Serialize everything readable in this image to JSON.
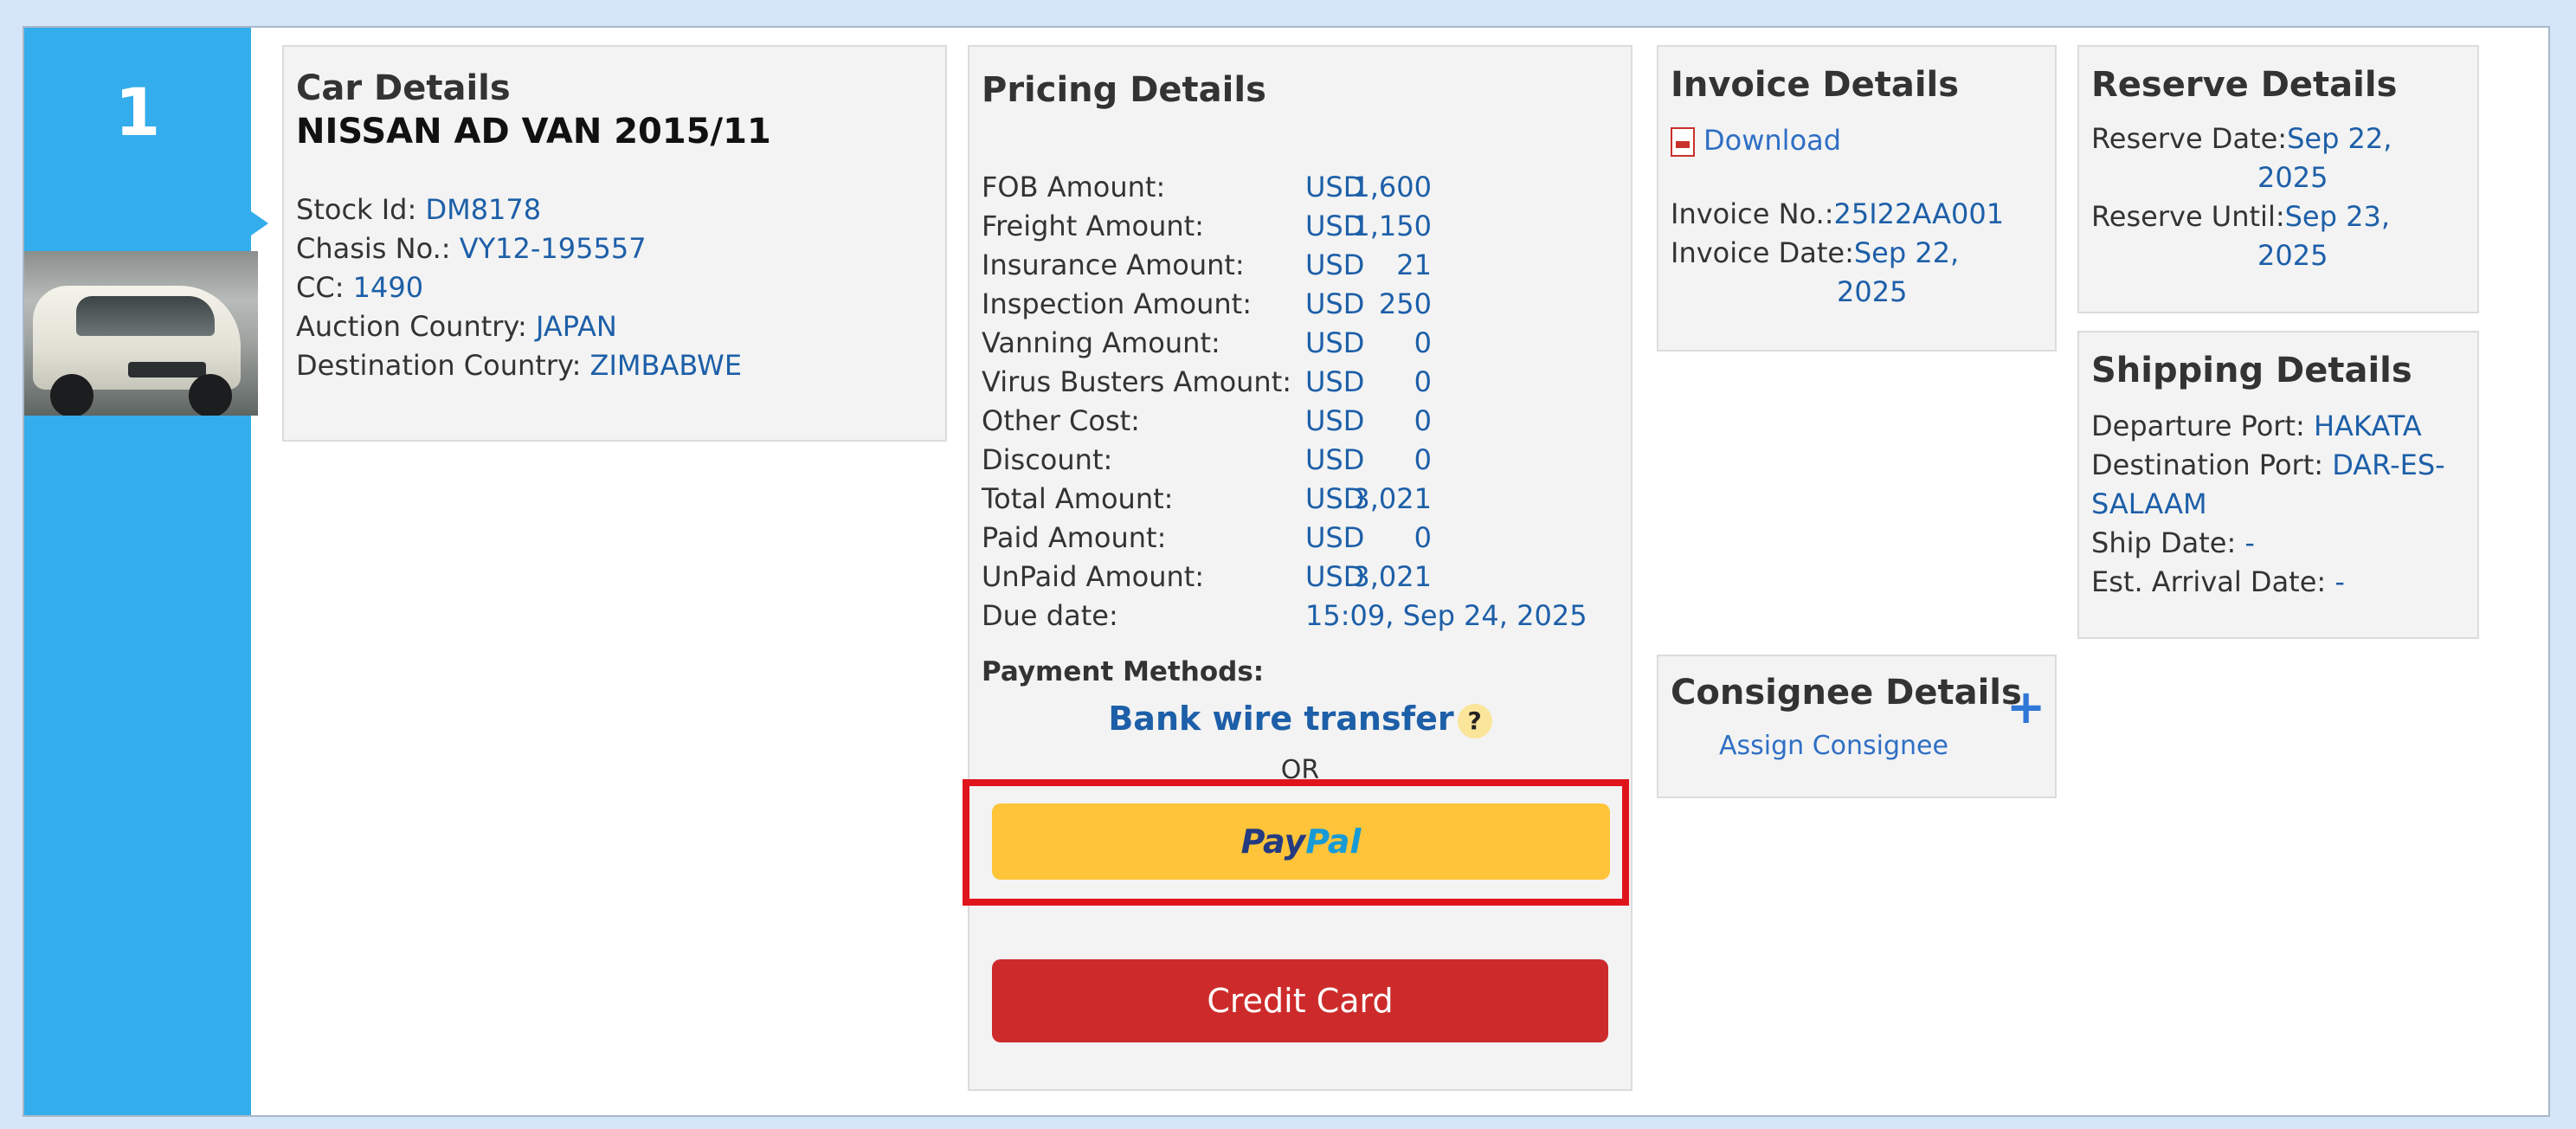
{
  "row_number": "1",
  "car": {
    "title": "Car Details",
    "name": "NISSAN AD VAN 2015/11",
    "fields": [
      {
        "label": "Stock Id:",
        "value": "DM8178"
      },
      {
        "label": "Chasis No.:",
        "value": "VY12-195557"
      },
      {
        "label": "CC:",
        "value": "1490"
      },
      {
        "label": "Auction Country:",
        "value": "JAPAN"
      },
      {
        "label": "Destination Country:",
        "value": "ZIMBABWE"
      }
    ]
  },
  "pricing": {
    "title": "Pricing Details",
    "rows": [
      {
        "label": "FOB Amount:",
        "currency": "USD",
        "amount": "1,600"
      },
      {
        "label": "Freight Amount:",
        "currency": "USD",
        "amount": "1,150"
      },
      {
        "label": "Insurance Amount:",
        "currency": "USD",
        "amount": "21"
      },
      {
        "label": "Inspection Amount:",
        "currency": "USD",
        "amount": "250"
      },
      {
        "label": "Vanning Amount:",
        "currency": "USD",
        "amount": "0"
      },
      {
        "label": "Virus Busters Amount:",
        "currency": "USD",
        "amount": "0"
      },
      {
        "label": "Other Cost:",
        "currency": "USD",
        "amount": "0"
      },
      {
        "label": "Discount:",
        "currency": "USD",
        "amount": "0"
      },
      {
        "label": "Total Amount:",
        "currency": "USD",
        "amount": "3,021"
      },
      {
        "label": "Paid Amount:",
        "currency": "USD",
        "amount": "0"
      },
      {
        "label": "UnPaid Amount:",
        "currency": "USD",
        "amount": "3,021"
      }
    ],
    "due_label": "Due date:",
    "due_value": "15:09, Sep 24, 2025",
    "payment_methods_label": "Payment Methods:",
    "bank_wire": "Bank wire transfer",
    "help_glyph": "?",
    "or_text": "OR",
    "paypal_part1": "Pay",
    "paypal_part2": "Pal",
    "credit_card": "Credit Card"
  },
  "invoice": {
    "title": "Invoice Details",
    "download": "Download",
    "invoice_no_label": "Invoice No.:",
    "invoice_no": "25I22AA001",
    "invoice_date_label": "Invoice Date:",
    "invoice_date_1": "Sep 22,",
    "invoice_date_2": "2025"
  },
  "consignee": {
    "title": "Consignee Details",
    "plus": "+",
    "assign": "Assign Consignee"
  },
  "reserve": {
    "title": "Reserve Details",
    "reserve_date_label": "Reserve Date:",
    "reserve_date_1": "Sep 22,",
    "reserve_date_2": "2025",
    "reserve_until_label": "Reserve Until:",
    "reserve_until_1": "Sep 23,",
    "reserve_until_2": "2025"
  },
  "shipping": {
    "title": "Shipping Details",
    "departure_label": "Departure Port:",
    "departure_value": "HAKATA",
    "destination_label": "Destination Port:",
    "destination_value_1": "DAR-ES-",
    "destination_value_2": "SALAAM",
    "ship_date_label": "Ship Date:",
    "ship_date_value": "-",
    "arrival_label": "Est. Arrival Date:",
    "arrival_value": "-"
  },
  "colors": {
    "accent_stripe": "#33adec",
    "paypal_yellow": "#ffc439",
    "credit_red": "#cd2b2b",
    "highlight_red": "#e0151b",
    "link_blue": "#1d5fa8"
  },
  "icons": [
    "pdf-icon",
    "help-icon",
    "plus-icon"
  ]
}
